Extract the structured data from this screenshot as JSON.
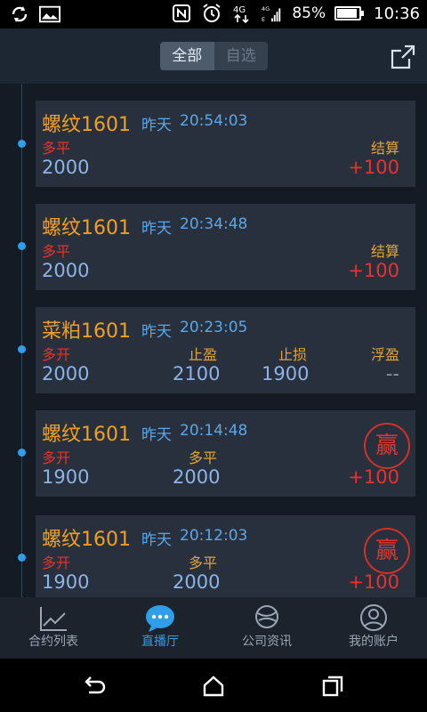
{
  "status_bar": {
    "battery_percent": "85%",
    "battery_level": 0.85,
    "time": "10:36",
    "network": "4G"
  },
  "header": {
    "segments": [
      "全部",
      "自选"
    ],
    "active_segment": "全部"
  },
  "feed": [
    {
      "name": "螺纹1601",
      "day": "昨天",
      "time": "20:54:03",
      "action": "多平",
      "right_label": "结算",
      "price": "2000",
      "result": "+100"
    },
    {
      "name": "螺纹1601",
      "day": "昨天",
      "time": "20:34:48",
      "action": "多平",
      "right_label": "结算",
      "price": "2000",
      "result": "+100"
    },
    {
      "name": "菜粕1601",
      "day": "昨天",
      "time": "20:23:05",
      "action": "多开",
      "take_profit_label": "止盈",
      "stop_loss_label": "止损",
      "float_label": "浮盈",
      "price": "2000",
      "take_profit": "2100",
      "stop_loss": "1900",
      "float_value": "--"
    },
    {
      "name": "螺纹1601",
      "day": "昨天",
      "time": "20:14:48",
      "action": "多开",
      "close_label": "多平",
      "badge": "赢",
      "price": "1900",
      "close_price": "2000",
      "result": "+100"
    },
    {
      "name": "螺纹1601",
      "day": "昨天",
      "time": "20:12:03",
      "action": "多开",
      "close_label": "多平",
      "badge": "赢",
      "price": "1900",
      "close_price": "2000",
      "result": "+100"
    }
  ],
  "tabbar": {
    "items": [
      {
        "label": "合约列表",
        "icon": "chart-line-icon"
      },
      {
        "label": "直播厅",
        "icon": "chat-bubble-icon"
      },
      {
        "label": "公司资讯",
        "icon": "globe-icon"
      },
      {
        "label": "我的账户",
        "icon": "user-icon"
      }
    ],
    "active_index": 1
  },
  "colors": {
    "accent": "#2e9fe8",
    "name": "#f0a020",
    "profit": "#e8322e",
    "value": "#8db4e6"
  }
}
